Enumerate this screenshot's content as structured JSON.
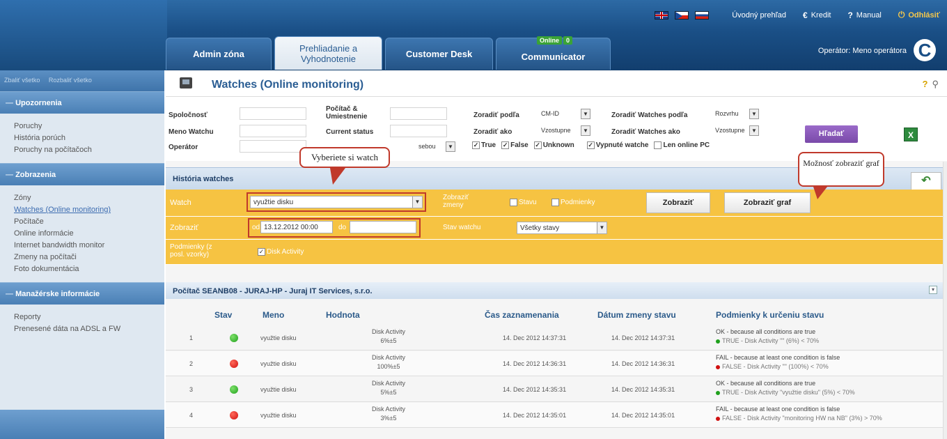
{
  "header": {
    "flags": [
      "uk-flag-icon",
      "cz-flag-icon",
      "sk-flag-icon"
    ],
    "links": {
      "overview": "Úvodný prehľad",
      "credit": "Kredit",
      "manual": "Manual",
      "logout": "Odhlásiť"
    },
    "tabs": [
      {
        "label": "Admin zóna"
      },
      {
        "label": "Prehliadanie a Vyhodnotenie"
      },
      {
        "label": "Customer Desk"
      },
      {
        "label": "Communicator"
      }
    ],
    "online_badge": {
      "status": "Online",
      "count": "0"
    },
    "operator": "Operátor: Meno operátora",
    "logo": "C"
  },
  "sidebar": {
    "collapse_all": "Zbaliť všetko",
    "expand_all": "Rozbaliť všetko",
    "sections": [
      {
        "title": "Upozornenia",
        "items": [
          "Poruchy",
          "História porúch",
          "Poruchy na počítačoch"
        ]
      },
      {
        "title": "Zobrazenia",
        "items": [
          "Zóny",
          "Watches (Online monitoring)",
          "Počítače",
          "Online informácie",
          "Internet bandwidth monitor",
          "Zmeny na počítači",
          "Foto dokumentácia"
        ]
      },
      {
        "title": "Manažérske informácie",
        "items": [
          "Reporty",
          "Prenesené dáta na ADSL a FW"
        ]
      }
    ],
    "active_item": "Watches (Online monitoring)"
  },
  "page": {
    "title": "Watches (Online monitoring)",
    "help": "?"
  },
  "filters": {
    "company_label": "Spoločnosť",
    "computer_label": "Počítač & Umiestnenie",
    "watch_name_label": "Meno Watchu",
    "current_status_label": "Current status",
    "operator_label": "Operátor",
    "operator_tail": "sebou",
    "sort_by_label": "Zoradiť podľa",
    "sort_by_value": "CM-ID",
    "sort_watches_by_label": "Zoradiť Watches podľa",
    "sort_watches_by_value": "Rozvrhu",
    "sort_as_label": "Zoradiť ako",
    "sort_as_value": "Vzostupne",
    "sort_watches_as_label": "Zoradiť Watches ako",
    "sort_watches_as_value": "Vzostupne",
    "true_label": "True",
    "false_label": "False",
    "unknown_label": "Unknown",
    "disabled_label": "Vypnuté watche",
    "online_only_label": "Len online PC",
    "search_button": "Hľadať",
    "excel_label": "X"
  },
  "callouts": {
    "pick_watch": "Vyberiete si watch",
    "show_graph": "Možnosť zobraziť graf"
  },
  "history": {
    "title": "História watches",
    "watch_label": "Watch",
    "watch_value": "využtie disku",
    "show_changes_label": "Zobraziť zmeny",
    "state_label": "Stavu",
    "conditions_label": "Podmienky",
    "show_button": "Zobraziť",
    "show_graph_button": "Zobraziť graf",
    "show_label": "Zobraziť",
    "from_label": "od",
    "from_value": "13.12.2012 00:00",
    "to_label": "do",
    "to_value": "",
    "watch_state_label": "Stav watchu",
    "watch_state_value": "Všetky stavy",
    "conditions_from_label": "Podmienky (z posl. vzorky)",
    "disk_activity_label": "Disk Activity"
  },
  "computer": {
    "title": "Počítač SEANB08 - JURAJ-HP - Juraj IT Services, s.r.o."
  },
  "table": {
    "headers": {
      "state": "Stav",
      "name": "Meno",
      "value": "Hodnota",
      "recorded": "Čas zaznamenania",
      "changed": "Dátum zmeny stavu",
      "conditions": "Podmienky k určeniu stavu"
    },
    "rows": [
      {
        "num": "1",
        "status": "ok",
        "name": "využtie disku",
        "value1": "Disk Activity",
        "value2": "6%±5",
        "recorded": "14. Dec 2012 14:37:31",
        "changed": "14. Dec 2012 14:37:31",
        "cond1": "OK - because all conditions are true",
        "cond2": "TRUE - Disk Activity \"\" (6%) < 70%"
      },
      {
        "num": "2",
        "status": "fail",
        "name": "využtie disku",
        "value1": "Disk Activity",
        "value2": "100%±5",
        "recorded": "14. Dec 2012 14:36:31",
        "changed": "14. Dec 2012 14:36:31",
        "cond1": "FAIL - because at least one condition is false",
        "cond2": "FALSE - Disk Activity \"\" (100%) < 70%"
      },
      {
        "num": "3",
        "status": "ok",
        "name": "využtie disku",
        "value1": "Disk Activity",
        "value2": "5%±5",
        "recorded": "14. Dec 2012 14:35:31",
        "changed": "14. Dec 2012 14:35:31",
        "cond1": "OK - because all conditions are true",
        "cond2": "TRUE - Disk Activity \"využtie disku\" (5%) < 70%"
      },
      {
        "num": "4",
        "status": "fail",
        "name": "využtie disku",
        "value1": "Disk Activity",
        "value2": "3%±5",
        "recorded": "14. Dec 2012 14:35:01",
        "changed": "14. Dec 2012 14:35:01",
        "cond1": "FAIL - because at least one condition is false",
        "cond2": "FALSE - Disk Activity \"monitoring HW na NB\" (3%) > 70%"
      }
    ]
  }
}
